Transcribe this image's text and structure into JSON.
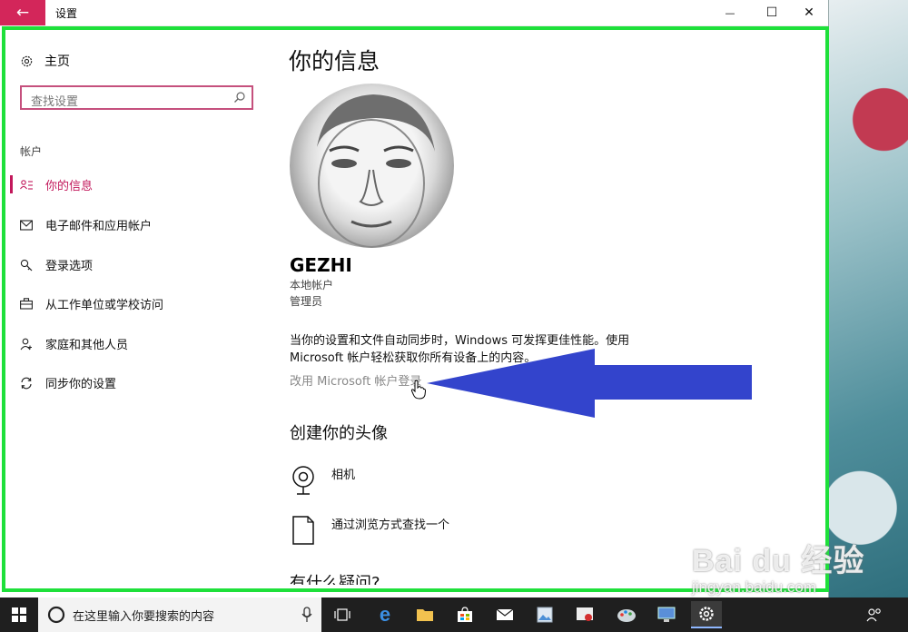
{
  "window": {
    "title": "设置",
    "back_icon": "←",
    "minimize_icon": "—",
    "maximize_icon": "☐",
    "close_icon": "✕"
  },
  "sidebar": {
    "home_label": "主页",
    "search_placeholder": "查找设置",
    "section_label": "帐户",
    "items": [
      {
        "label": "你的信息",
        "icon": "person-list-icon",
        "active": true
      },
      {
        "label": "电子邮件和应用帐户",
        "icon": "mail-icon",
        "active": false
      },
      {
        "label": "登录选项",
        "icon": "key-icon",
        "active": false
      },
      {
        "label": "从工作单位或学校访问",
        "icon": "briefcase-icon",
        "active": false
      },
      {
        "label": "家庭和其他人员",
        "icon": "add-person-icon",
        "active": false
      },
      {
        "label": "同步你的设置",
        "icon": "sync-icon",
        "active": false
      }
    ]
  },
  "main": {
    "page_title": "你的信息",
    "user_name": "GEZHI",
    "account_type": "本地帐户",
    "role": "管理员",
    "info_line1": "当你的设置和文件自动同步时，Windows 可发挥更佳性能。使用",
    "info_line2": "Microsoft 帐户轻松获取你所有设备上的内容。",
    "ms_link": "改用 Microsoft 帐户登录",
    "avatar_section_title": "创建你的头像",
    "camera_label": "相机",
    "browse_label": "通过浏览方式查找一个",
    "faq_title": "有什么疑问?"
  },
  "taskbar": {
    "search_text": "在这里输入你要搜索的内容"
  },
  "watermark": {
    "line1": "Bai du 经验",
    "line2": "jingyan.baidu.com"
  },
  "colors": {
    "accent": "#c2185b",
    "highlight_frame": "#1ee03a",
    "arrow": "#3344cc"
  }
}
